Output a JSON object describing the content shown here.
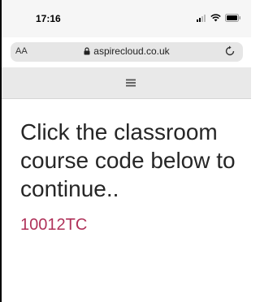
{
  "status_bar": {
    "time": "17:16"
  },
  "browser": {
    "text_size_label": "AA",
    "url": "aspirecloud.co.uk"
  },
  "page": {
    "heading": "Click the classroom course code below to continue..",
    "course_code": "10012TC"
  },
  "colors": {
    "link": "#b0325a",
    "heading": "#262626",
    "menu_bg": "#e9e9e9"
  },
  "icons": [
    "signal-icon",
    "wifi-icon",
    "battery-icon",
    "lock-icon",
    "reload-icon",
    "hamburger-menu-icon"
  ]
}
